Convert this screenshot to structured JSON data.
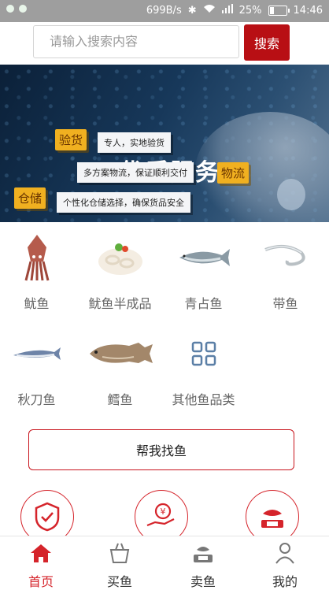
{
  "status_bar": {
    "network_speed": "699B/s",
    "battery": "25%",
    "battery_level": 0.25,
    "time": "14:46"
  },
  "search": {
    "placeholder": "请输入搜索内容",
    "button_label": "搜索"
  },
  "banner": {
    "title": "优质服务",
    "items": [
      {
        "tag": "验货",
        "text": "专人，实地验货"
      },
      {
        "tag": "物流",
        "text": "多方案物流，保证顺利交付"
      },
      {
        "tag": "仓储",
        "text": "个性化仓储选择，确保货品安全"
      }
    ]
  },
  "categories": [
    {
      "label": "鱿鱼",
      "icon": "squid-image"
    },
    {
      "label": "鱿鱼半成品",
      "icon": "squid-rings-image"
    },
    {
      "label": "青占鱼",
      "icon": "mackerel-image"
    },
    {
      "label": "带鱼",
      "icon": "hairtail-image"
    },
    {
      "label": "秋刀鱼",
      "icon": "saury-image"
    },
    {
      "label": "鳕鱼",
      "icon": "cod-image"
    },
    {
      "label": "其他鱼品类",
      "icon": "grid-icon"
    }
  ],
  "find_fish_button": "帮我找鱼",
  "features": [
    {
      "icon": "shield-check-icon"
    },
    {
      "icon": "yuan-hand-icon"
    },
    {
      "icon": "fish-scale-icon"
    }
  ],
  "colors": {
    "brand_red": "#d5242b",
    "search_button": "#b80f14"
  },
  "tabs": [
    {
      "label": "首页",
      "icon": "home-icon",
      "active": true
    },
    {
      "label": "买鱼",
      "icon": "basket-icon",
      "active": false
    },
    {
      "label": "卖鱼",
      "icon": "scale-icon",
      "active": false
    },
    {
      "label": "我的",
      "icon": "person-icon",
      "active": false
    }
  ]
}
